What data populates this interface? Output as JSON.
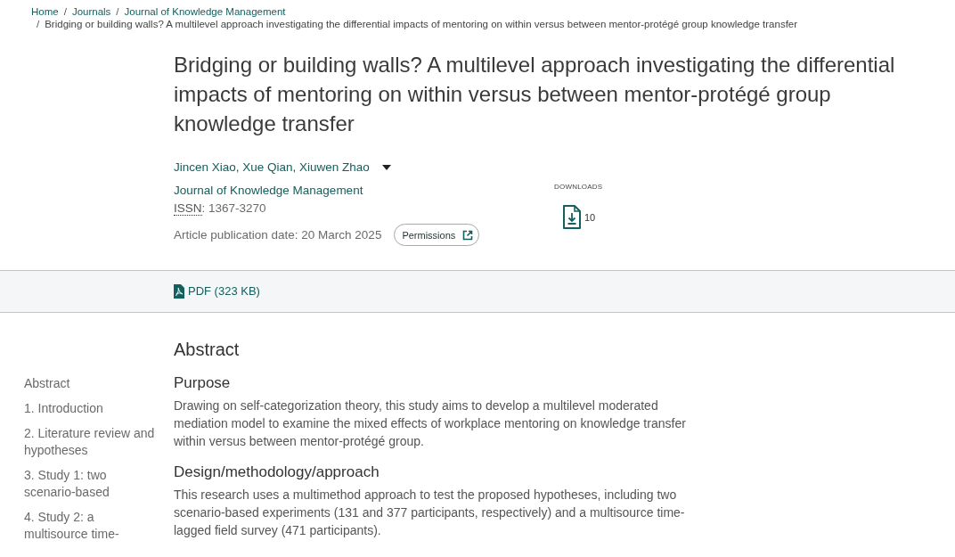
{
  "breadcrumb": {
    "links": [
      {
        "label": "Home"
      },
      {
        "prefix": "/",
        "label": "Journals"
      },
      {
        "prefix": "/",
        "label": "Journal of Knowledge Management"
      }
    ],
    "current": {
      "prefix": "/",
      "label": "Bridging or building walls? A multilevel approach investigating the differential impacts of mentoring on within versus between mentor-protégé group knowledge transfer"
    }
  },
  "article": {
    "title": "Bridging or building walls? A multilevel approach investigating the differential impacts of mentoring on within versus between mentor-protégé group knowledge transfer",
    "authors": "Jincen Xiao, Xue Qian, Xiuwen Zhao",
    "authors_expanded": false,
    "journal": "Journal of Knowledge Management",
    "issn": {
      "label": "ISSN",
      "text_after": ": 1367-3270"
    },
    "publication_date": "Article publication date: 20 March 2025",
    "permissions_button": "Permissions"
  },
  "downloads": {
    "label": "DOWNLOADS",
    "count": "10"
  },
  "pdf_link": "PDF (323 KB)",
  "sidebar": {
    "items": [
      {
        "label": "Abstract"
      },
      {
        "label": "1. Introduction"
      },
      {
        "label": "2. Literature review and hypotheses"
      },
      {
        "label": "3. Study 1: two scenario-based"
      },
      {
        "label": "4. Study 2: a multisource time-"
      }
    ]
  },
  "abstract": {
    "heading": "Abstract",
    "sections": [
      {
        "heading": "Purpose",
        "text": "Drawing on self-categorization theory, this study aims to develop a multilevel moderated mediation model to examine the mixed effects of workplace mentoring on knowledge transfer within versus between mentor-protégé group."
      },
      {
        "heading": "Design/methodology/approach",
        "text": "This research uses a multimethod approach to test the proposed hypotheses, including two scenario-based experiments (131 and 377 participants, respectively) and a multisource time-lagged field survey (471 participants)."
      }
    ]
  }
}
